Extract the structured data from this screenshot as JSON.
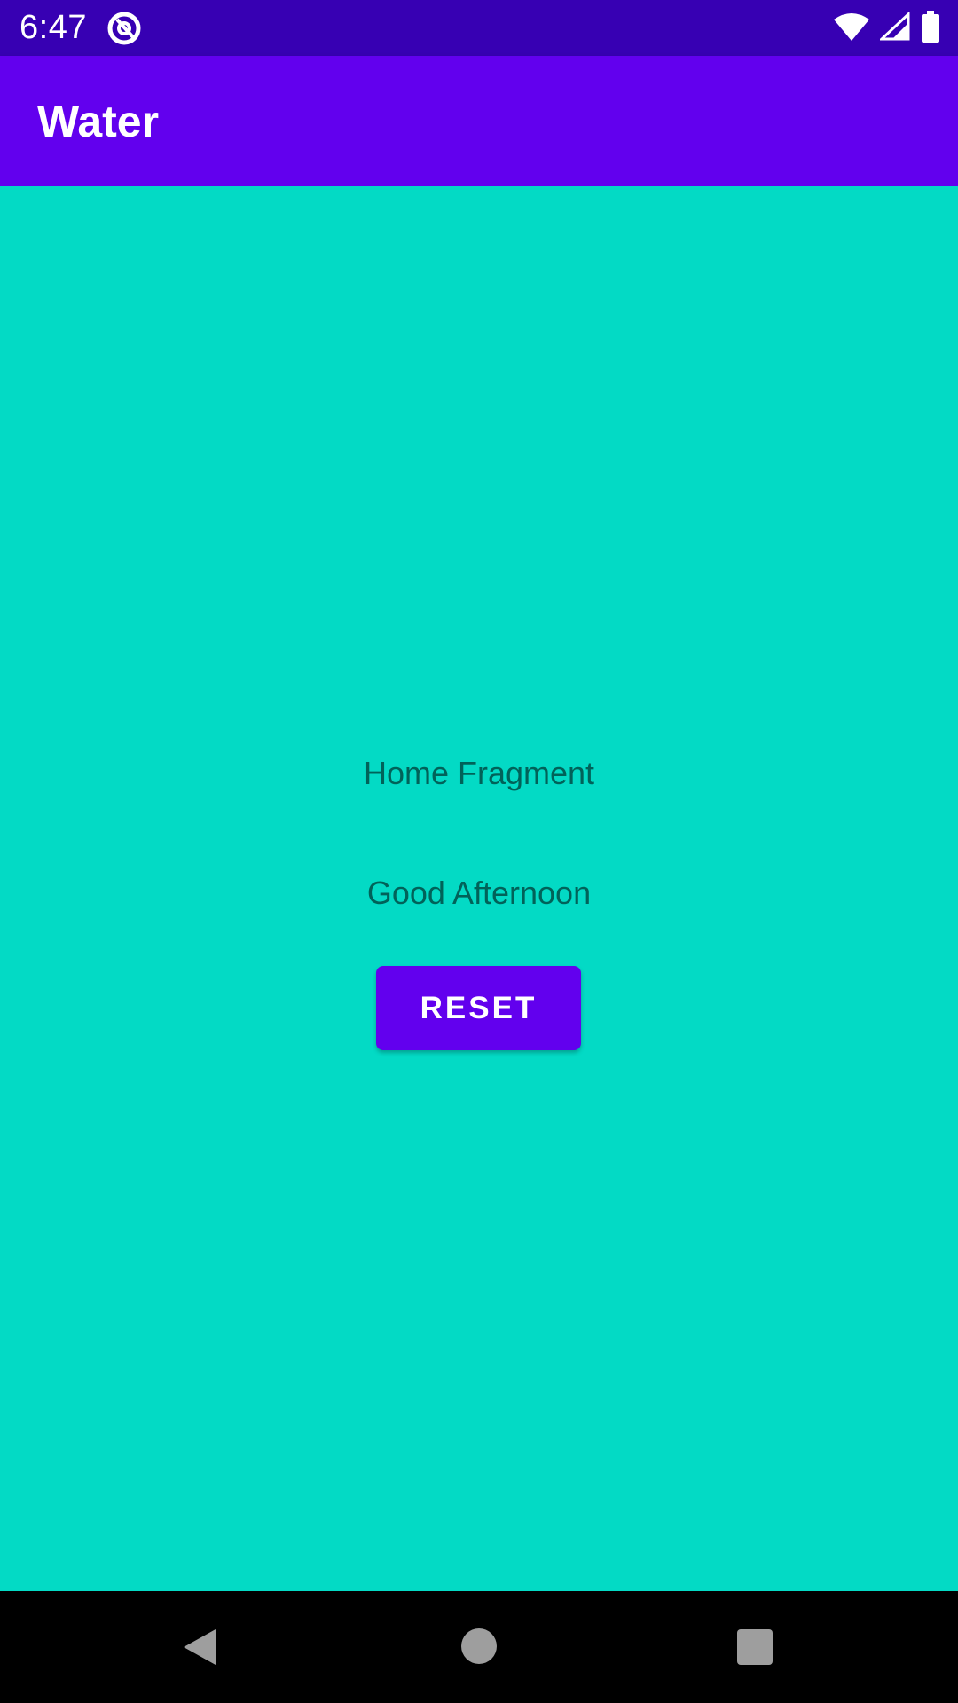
{
  "status_bar": {
    "time": "6:47",
    "icons": [
      "app-notification-icon",
      "wifi-icon",
      "cellular-signal-icon",
      "battery-icon"
    ]
  },
  "app_bar": {
    "title": "Water",
    "color": "#6200EE"
  },
  "main": {
    "background_color": "#03DAC5",
    "fragment_label": "Home Fragment",
    "greeting": "Good Afternoon",
    "reset_button_label": "RESET"
  },
  "nav_bar": {
    "icons": [
      "back-icon",
      "home-icon",
      "recents-icon"
    ]
  }
}
